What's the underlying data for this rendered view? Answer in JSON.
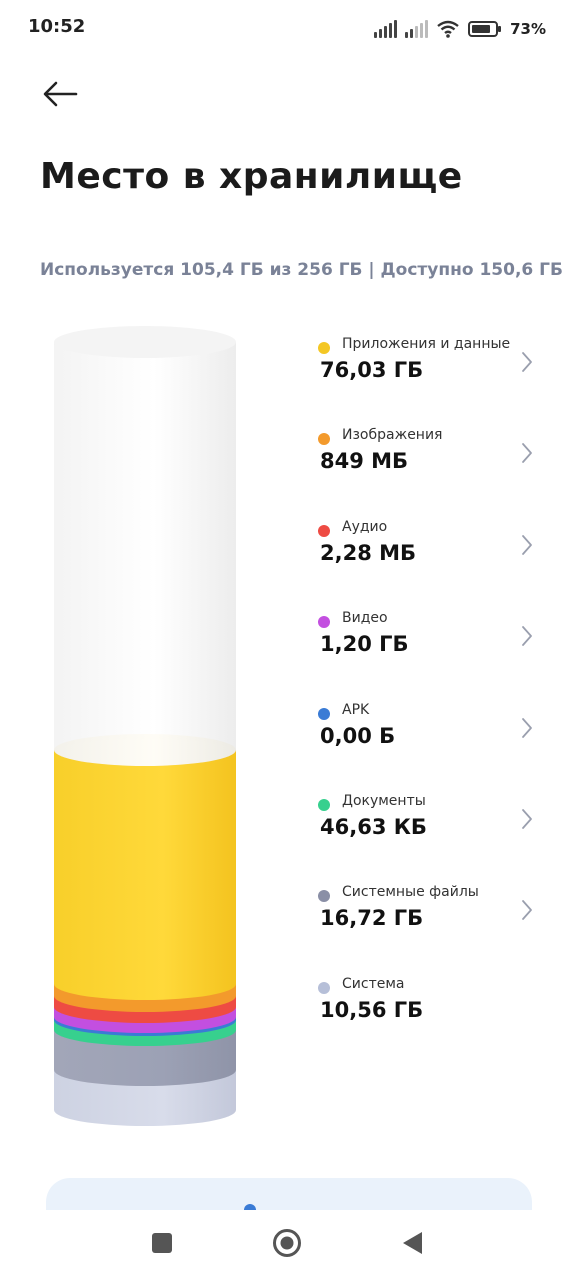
{
  "status_bar": {
    "time": "10:52",
    "battery": "73%"
  },
  "header": {
    "title": "Место в хранилище",
    "summary": "Используется 105,4 ГБ из 256 ГБ | Доступно 150,6 ГБ"
  },
  "storage": {
    "used_gb": 105.4,
    "total_gb": 256,
    "available_gb": 150.6
  },
  "categories": [
    {
      "label": "Приложения и данные",
      "value": "76,03 ГБ",
      "color": "#f4c724",
      "has_chevron": true
    },
    {
      "label": "Изображения",
      "value": "849 МБ",
      "color": "#f39a2c",
      "has_chevron": true
    },
    {
      "label": "Аудио",
      "value": "2,28 МБ",
      "color": "#ee4b43",
      "has_chevron": true
    },
    {
      "label": "Видео",
      "value": "1,20 ГБ",
      "color": "#c34fe0",
      "has_chevron": true
    },
    {
      "label": "APK",
      "value": "0,00 Б",
      "color": "#3a7bd5",
      "has_chevron": true
    },
    {
      "label": "Документы",
      "value": "46,63 КБ",
      "color": "#37d08e",
      "has_chevron": true
    },
    {
      "label": "Системные файлы",
      "value": "16,72 ГБ",
      "color": "#8a8fa6",
      "has_chevron": true
    },
    {
      "label": "Система",
      "value": "10,56 ГБ",
      "color": "#b6bfd8",
      "has_chevron": false
    }
  ],
  "icons": {
    "back": "arrow-left-icon",
    "chevron": "chevron-right-icon",
    "nav_recents": "square-icon",
    "nav_home": "circle-icon",
    "nav_back": "triangle-icon"
  }
}
